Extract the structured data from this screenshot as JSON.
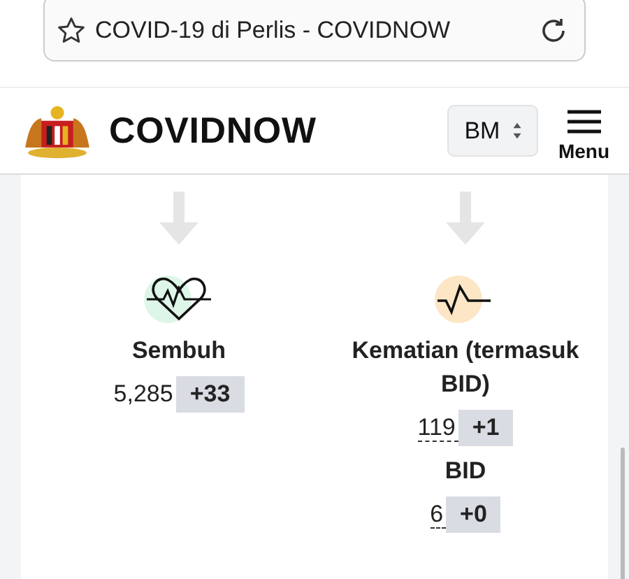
{
  "url_bar": {
    "title": "COVID-19 di Perlis - COVIDNOW"
  },
  "header": {
    "brand": "COVIDNOW",
    "language": "BM",
    "menu_label": "Menu"
  },
  "stats": [
    {
      "kind": "recovered",
      "label": "Sembuh",
      "value": "5,285",
      "delta": "+33",
      "tooltip": false
    },
    {
      "kind": "deaths",
      "label": "Kematian (termasuk BID)",
      "value": "119",
      "delta": "+1",
      "tooltip": true,
      "sub": {
        "label": "BID",
        "value": "6",
        "delta": "+0",
        "tooltip": true
      }
    }
  ]
}
